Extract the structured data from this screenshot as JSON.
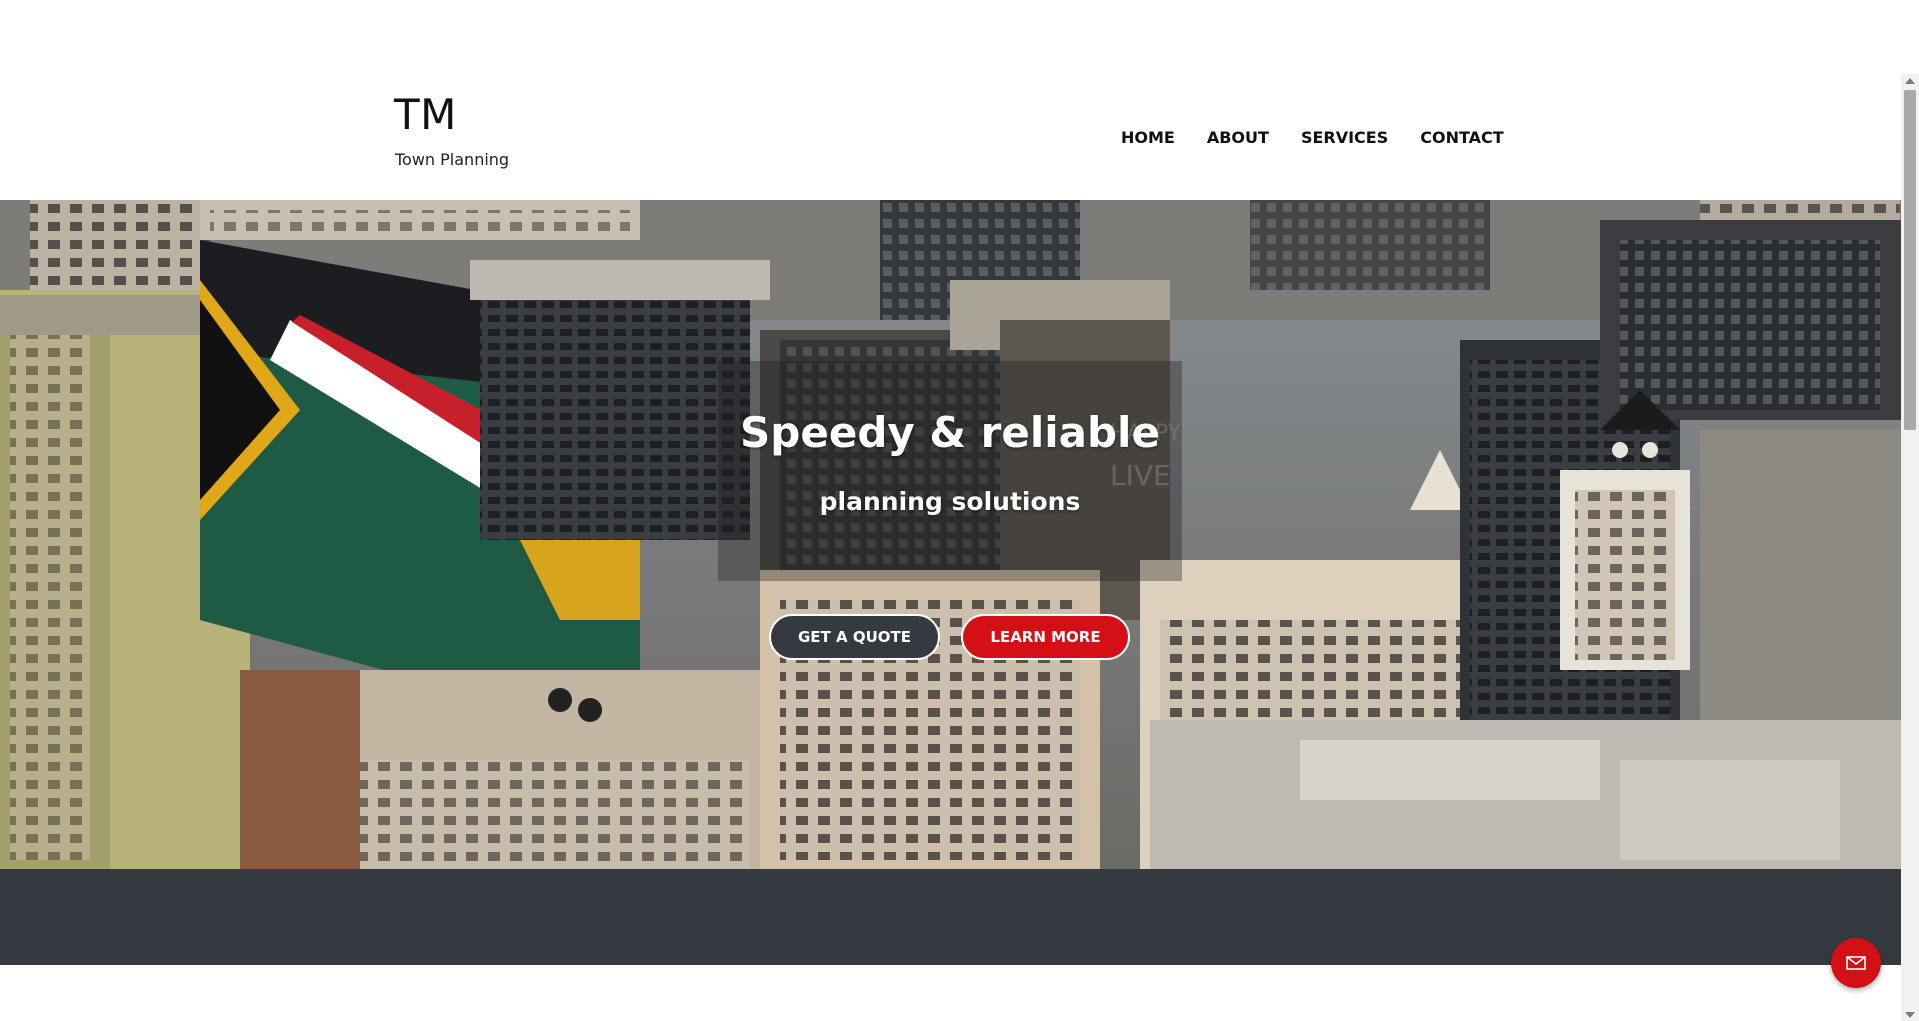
{
  "brand": {
    "title": "TM",
    "subtitle": "Town Planning"
  },
  "nav": {
    "items": [
      "HOME",
      "ABOUT",
      "SERVICES",
      "CONTACT"
    ]
  },
  "hero": {
    "heading": "Speedy & reliable",
    "subheading": "planning solutions",
    "buttons": {
      "quote_label": "GET A QUOTE",
      "more_label": "LEARN MORE"
    },
    "background_image": "aerial-city-skyline"
  },
  "floating_button": {
    "icon": "envelope-icon",
    "glyph": "✉"
  },
  "colors": {
    "accent_red": "#d50f16",
    "dark": "#343a40",
    "white": "#ffffff"
  }
}
